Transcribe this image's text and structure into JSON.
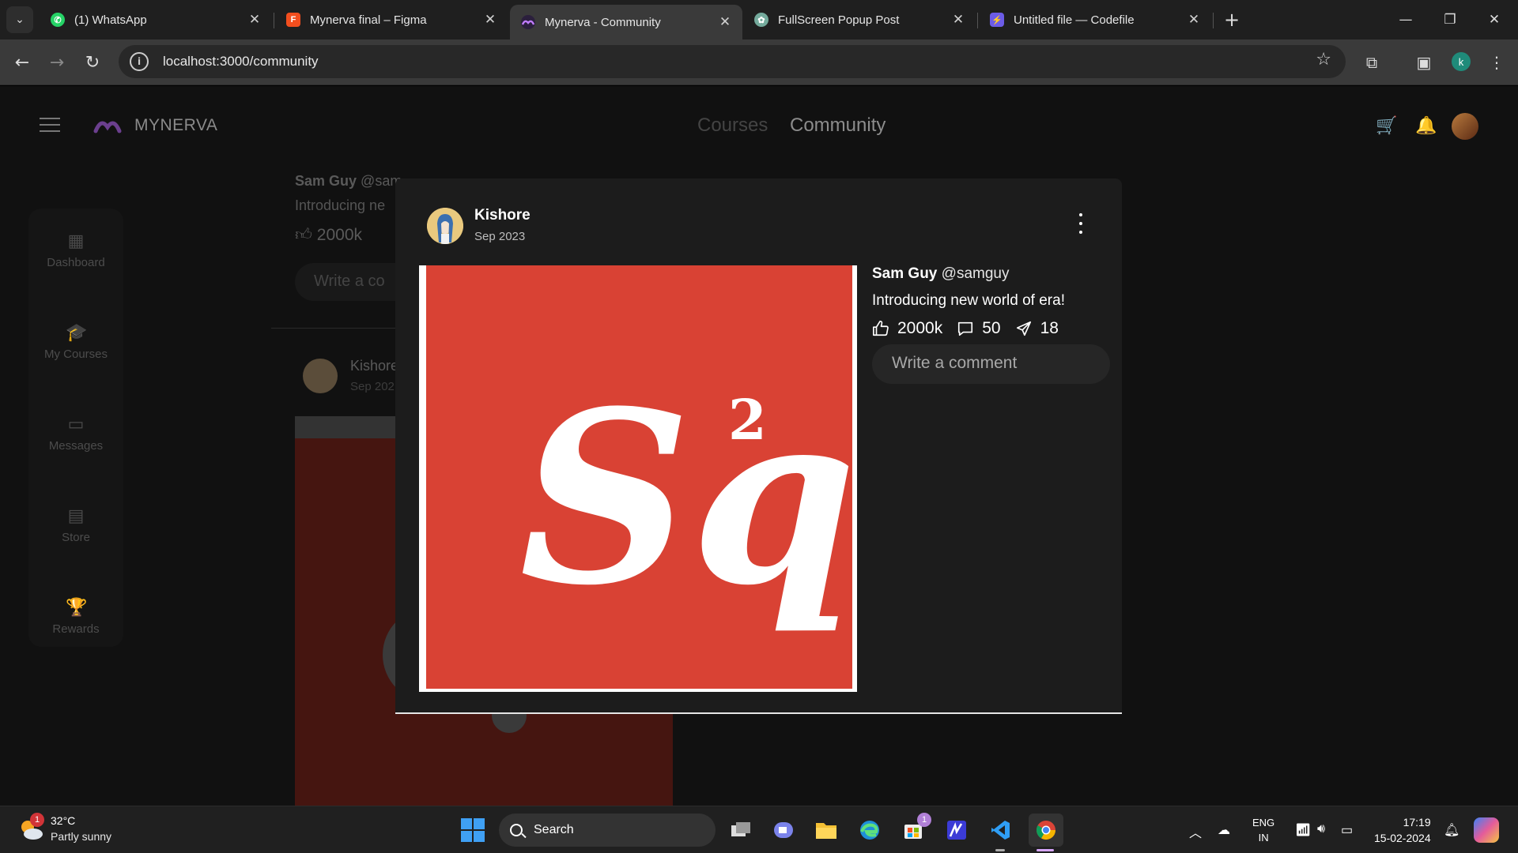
{
  "browser": {
    "tabs": [
      {
        "title": "(1) WhatsApp",
        "favicon": "whatsapp-icon",
        "color": "#25d366",
        "active": false
      },
      {
        "title": "Mynerva final – Figma",
        "favicon": "figma-icon",
        "color": "#f24e1e",
        "active": false
      },
      {
        "title": "Mynerva - Community",
        "favicon": "mynerva-icon",
        "color": "#8b5cf6",
        "active": true
      },
      {
        "title": "FullScreen Popup Post",
        "favicon": "chatgpt-icon",
        "color": "#74aa9c",
        "active": false
      },
      {
        "title": "Untitled file — Codefile",
        "favicon": "codefile-icon",
        "color": "#6c5ce7",
        "active": false
      }
    ],
    "url": "localhost:3000/community",
    "profile_initial": "k"
  },
  "app": {
    "brand": "MYNERVA",
    "nav": {
      "courses": "Courses",
      "community": "Community"
    },
    "sidebar": [
      {
        "label": "Dashboard",
        "icon": "grid-icon"
      },
      {
        "label": "My Courses",
        "icon": "graduation-cap-icon"
      },
      {
        "label": "Messages",
        "icon": "chat-bubble-icon"
      },
      {
        "label": "Store",
        "icon": "store-icon"
      },
      {
        "label": "Rewards",
        "icon": "trophy-icon"
      }
    ]
  },
  "feed": {
    "author_name": "Sam Guy",
    "author_handle": "@sam",
    "text": "Introducing ne",
    "likes": "2000k",
    "comment_placeholder": "Write a co",
    "post2_name": "Kishore",
    "post2_date": "Sep 202"
  },
  "modal": {
    "poster_name": "Kishore",
    "poster_date": "Sep 2023",
    "image_text": "Sq",
    "image_sup": "2",
    "image_bg": "#d94234",
    "author_name": "Sam Guy",
    "author_handle": "@samguy",
    "caption": "Introducing new world of era!",
    "likes": "2000k",
    "comments": "50",
    "shares": "18",
    "comment_placeholder": "Write a comment"
  },
  "taskbar": {
    "weather_badge": "1",
    "temperature": "32°C",
    "condition": "Partly sunny",
    "search_label": "Search",
    "store_badge": "1",
    "lang_line1": "ENG",
    "lang_line2": "IN",
    "time": "17:19",
    "date": "15-02-2024"
  }
}
